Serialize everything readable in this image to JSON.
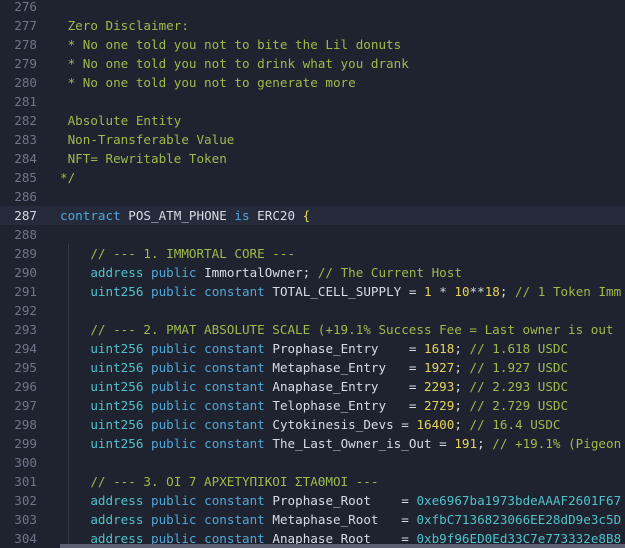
{
  "editor": {
    "active_line": "287",
    "lines": [
      {
        "n": "276",
        "tokens": []
      },
      {
        "n": "277",
        "tokens": [
          {
            "t": " Zero Disclaimer:",
            "c": "comment"
          }
        ]
      },
      {
        "n": "278",
        "tokens": [
          {
            "t": " * No one told you not to bite the Lil donuts",
            "c": "comment"
          }
        ]
      },
      {
        "n": "279",
        "tokens": [
          {
            "t": " * No one told you not to drink what you drank",
            "c": "comment"
          }
        ]
      },
      {
        "n": "280",
        "tokens": [
          {
            "t": " * No one told you not to generate more",
            "c": "comment"
          }
        ]
      },
      {
        "n": "281",
        "tokens": []
      },
      {
        "n": "282",
        "tokens": [
          {
            "t": " Absolute Entity",
            "c": "comment"
          }
        ]
      },
      {
        "n": "283",
        "tokens": [
          {
            "t": " Non-Transferable Value",
            "c": "comment"
          }
        ]
      },
      {
        "n": "284",
        "tokens": [
          {
            "t": " NFT= Rewritable Token",
            "c": "comment"
          }
        ]
      },
      {
        "n": "285",
        "tokens": [
          {
            "t": "*/",
            "c": "comment"
          }
        ]
      },
      {
        "n": "286",
        "tokens": []
      },
      {
        "n": "287",
        "tokens": [
          {
            "t": "contract",
            "c": "kw"
          },
          {
            "t": " POS_ATM_PHONE ",
            "c": "ident"
          },
          {
            "t": "is",
            "c": "kw"
          },
          {
            "t": " ERC20 ",
            "c": "ident"
          },
          {
            "t": "{",
            "c": "brace"
          }
        ]
      },
      {
        "n": "288",
        "tokens": []
      },
      {
        "n": "289",
        "tokens": [
          {
            "t": "    // --- 1. IMMORTAL CORE ---",
            "c": "comment"
          }
        ]
      },
      {
        "n": "290",
        "tokens": [
          {
            "t": "    ",
            "c": "ident"
          },
          {
            "t": "address",
            "c": "type"
          },
          {
            "t": " ",
            "c": "ident"
          },
          {
            "t": "public",
            "c": "kw"
          },
          {
            "t": " ImmortalOwner; ",
            "c": "ident"
          },
          {
            "t": "// The Current Host",
            "c": "comment"
          }
        ]
      },
      {
        "n": "291",
        "tokens": [
          {
            "t": "    ",
            "c": "ident"
          },
          {
            "t": "uint256",
            "c": "type"
          },
          {
            "t": " ",
            "c": "ident"
          },
          {
            "t": "public",
            "c": "kw"
          },
          {
            "t": " ",
            "c": "ident"
          },
          {
            "t": "constant",
            "c": "kw"
          },
          {
            "t": " TOTAL_CELL_SUPPLY = ",
            "c": "ident"
          },
          {
            "t": "1",
            "c": "num"
          },
          {
            "t": " * ",
            "c": "ident"
          },
          {
            "t": "10",
            "c": "num"
          },
          {
            "t": "**",
            "c": "ident"
          },
          {
            "t": "18",
            "c": "num"
          },
          {
            "t": "; ",
            "c": "ident"
          },
          {
            "t": "// 1 Token Imm",
            "c": "comment"
          }
        ]
      },
      {
        "n": "292",
        "tokens": []
      },
      {
        "n": "293",
        "tokens": [
          {
            "t": "    // --- 2. PMAT ABSOLUTE SCALE (+19.1% Success Fee = Last owner is out",
            "c": "comment"
          }
        ]
      },
      {
        "n": "294",
        "tokens": [
          {
            "t": "    ",
            "c": "ident"
          },
          {
            "t": "uint256",
            "c": "type"
          },
          {
            "t": " ",
            "c": "ident"
          },
          {
            "t": "public",
            "c": "kw"
          },
          {
            "t": " ",
            "c": "ident"
          },
          {
            "t": "constant",
            "c": "kw"
          },
          {
            "t": " Prophase_Entry    = ",
            "c": "ident"
          },
          {
            "t": "1618",
            "c": "num"
          },
          {
            "t": "; ",
            "c": "ident"
          },
          {
            "t": "// 1.618 USDC",
            "c": "comment"
          }
        ]
      },
      {
        "n": "295",
        "tokens": [
          {
            "t": "    ",
            "c": "ident"
          },
          {
            "t": "uint256",
            "c": "type"
          },
          {
            "t": " ",
            "c": "ident"
          },
          {
            "t": "public",
            "c": "kw"
          },
          {
            "t": " ",
            "c": "ident"
          },
          {
            "t": "constant",
            "c": "kw"
          },
          {
            "t": " Metaphase_Entry   = ",
            "c": "ident"
          },
          {
            "t": "1927",
            "c": "num"
          },
          {
            "t": "; ",
            "c": "ident"
          },
          {
            "t": "// 1.927 USDC",
            "c": "comment"
          }
        ]
      },
      {
        "n": "296",
        "tokens": [
          {
            "t": "    ",
            "c": "ident"
          },
          {
            "t": "uint256",
            "c": "type"
          },
          {
            "t": " ",
            "c": "ident"
          },
          {
            "t": "public",
            "c": "kw"
          },
          {
            "t": " ",
            "c": "ident"
          },
          {
            "t": "constant",
            "c": "kw"
          },
          {
            "t": " Anaphase_Entry    = ",
            "c": "ident"
          },
          {
            "t": "2293",
            "c": "num"
          },
          {
            "t": "; ",
            "c": "ident"
          },
          {
            "t": "// 2.293 USDC",
            "c": "comment"
          }
        ]
      },
      {
        "n": "297",
        "tokens": [
          {
            "t": "    ",
            "c": "ident"
          },
          {
            "t": "uint256",
            "c": "type"
          },
          {
            "t": " ",
            "c": "ident"
          },
          {
            "t": "public",
            "c": "kw"
          },
          {
            "t": " ",
            "c": "ident"
          },
          {
            "t": "constant",
            "c": "kw"
          },
          {
            "t": " Telophase_Entry   = ",
            "c": "ident"
          },
          {
            "t": "2729",
            "c": "num"
          },
          {
            "t": "; ",
            "c": "ident"
          },
          {
            "t": "// 2.729 USDC",
            "c": "comment"
          }
        ]
      },
      {
        "n": "298",
        "tokens": [
          {
            "t": "    ",
            "c": "ident"
          },
          {
            "t": "uint256",
            "c": "type"
          },
          {
            "t": " ",
            "c": "ident"
          },
          {
            "t": "public",
            "c": "kw"
          },
          {
            "t": " ",
            "c": "ident"
          },
          {
            "t": "constant",
            "c": "kw"
          },
          {
            "t": " Cytokinesis_Devs = ",
            "c": "ident"
          },
          {
            "t": "16400",
            "c": "num"
          },
          {
            "t": "; ",
            "c": "ident"
          },
          {
            "t": "// 16.4 USDC",
            "c": "comment"
          }
        ]
      },
      {
        "n": "299",
        "tokens": [
          {
            "t": "    ",
            "c": "ident"
          },
          {
            "t": "uint256",
            "c": "type"
          },
          {
            "t": " ",
            "c": "ident"
          },
          {
            "t": "public",
            "c": "kw"
          },
          {
            "t": " ",
            "c": "ident"
          },
          {
            "t": "constant",
            "c": "kw"
          },
          {
            "t": " The_Last_Owner_is_Out = ",
            "c": "ident"
          },
          {
            "t": "191",
            "c": "num"
          },
          {
            "t": "; ",
            "c": "ident"
          },
          {
            "t": "// +19.1% (Pigeon",
            "c": "comment"
          }
        ]
      },
      {
        "n": "300",
        "tokens": []
      },
      {
        "n": "301",
        "tokens": [
          {
            "t": "    // --- 3. ΟΙ 7 ΑΡΧΕΤΥΠΙΚΟΙ ΣΤΑΘΜΟΙ ---",
            "c": "comment"
          }
        ]
      },
      {
        "n": "302",
        "tokens": [
          {
            "t": "    ",
            "c": "ident"
          },
          {
            "t": "address",
            "c": "type"
          },
          {
            "t": " ",
            "c": "ident"
          },
          {
            "t": "public",
            "c": "kw"
          },
          {
            "t": " ",
            "c": "ident"
          },
          {
            "t": "constant",
            "c": "kw"
          },
          {
            "t": " Prophase_Root    = ",
            "c": "ident"
          },
          {
            "t": "0xe6967ba1973bdeAAAF2601F67",
            "c": "addr"
          }
        ]
      },
      {
        "n": "303",
        "tokens": [
          {
            "t": "    ",
            "c": "ident"
          },
          {
            "t": "address",
            "c": "type"
          },
          {
            "t": " ",
            "c": "ident"
          },
          {
            "t": "public",
            "c": "kw"
          },
          {
            "t": " ",
            "c": "ident"
          },
          {
            "t": "constant",
            "c": "kw"
          },
          {
            "t": " Metaphase_Root   = ",
            "c": "ident"
          },
          {
            "t": "0xfbC7136823066EE28dD9e3c5D",
            "c": "addr"
          }
        ]
      },
      {
        "n": "304",
        "tokens": [
          {
            "t": "    ",
            "c": "ident"
          },
          {
            "t": "address",
            "c": "type"
          },
          {
            "t": " ",
            "c": "ident"
          },
          {
            "t": "public",
            "c": "kw"
          },
          {
            "t": " ",
            "c": "ident"
          },
          {
            "t": "constant",
            "c": "kw"
          },
          {
            "t": " Anaphase_Root    = ",
            "c": "ident"
          },
          {
            "t": "0xb9f96ED0Ed33C7e773332e8B8",
            "c": "addr"
          }
        ]
      }
    ]
  },
  "colors": {
    "background": "#1f2330",
    "active_line": "#262b3b",
    "comment": "#9cbb4c",
    "keyword": "#4fa8d8",
    "type": "#4fc1c9",
    "number": "#e6d35a",
    "identifier": "#d8dce4",
    "line_number": "#6e7688"
  }
}
